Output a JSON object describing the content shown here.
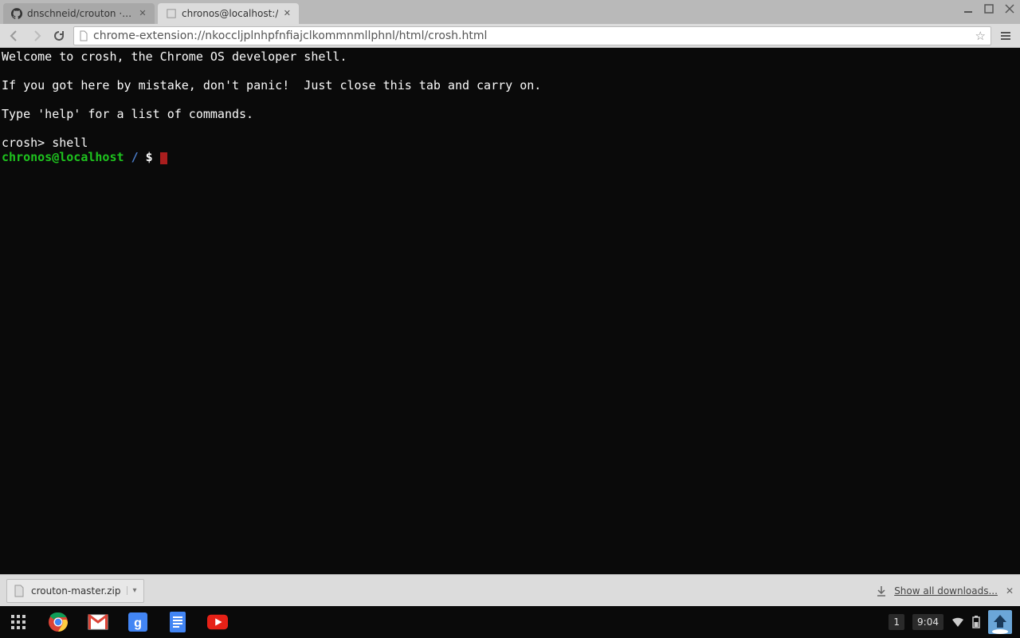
{
  "tabs": [
    {
      "title": "dnschneid/crouton · GitH",
      "active": false,
      "favicon": "github"
    },
    {
      "title": "chronos@localhost:/",
      "active": true,
      "favicon": "page"
    }
  ],
  "url": "chrome-extension://nkoccljplnhpfnfiajclkommnmllphnl/html/crosh.html",
  "terminal": {
    "line1": "Welcome to crosh, the Chrome OS developer shell.",
    "line2": "If you got here by mistake, don't panic!  Just close this tab and carry on.",
    "line3": "Type 'help' for a list of commands.",
    "prompt1": "crosh> ",
    "cmd1": "shell",
    "user": "chronos@localhost",
    "path": "/",
    "sigil": "$"
  },
  "download": {
    "filename": "crouton-master.zip",
    "show_all": "Show all downloads..."
  },
  "shelf": {
    "notification_count": "1",
    "clock": "9:04"
  }
}
